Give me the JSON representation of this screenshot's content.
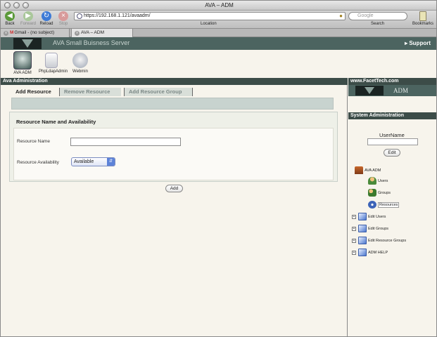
{
  "window": {
    "title": "AVA – ADM"
  },
  "toolbar": {
    "back": "Back",
    "forward": "Forward",
    "reload": "Reload",
    "stop": "Stop",
    "url": "https://192.168.1.121/avaadm/",
    "location_label": "Location",
    "search_placeholder": "Google",
    "search_label": "Search",
    "bookmarks": "Bookmarks"
  },
  "tabs": [
    {
      "label": "Gmail - (no subject)"
    },
    {
      "label": "AVA – ADM"
    }
  ],
  "banner": {
    "title": "AVA Small Buisness Server",
    "support": "▸ Support"
  },
  "apps": [
    {
      "label": "AVA ADM",
      "icon": "ava-adm-icon"
    },
    {
      "label": "PhpLdapAdmin",
      "icon": "phpldapadmin-icon"
    },
    {
      "label": "Webmin",
      "icon": "webmin-icon"
    }
  ],
  "main": {
    "header": "Ava Administration",
    "tabs": [
      {
        "label": "Add Resource"
      },
      {
        "label": "Remove Resource"
      },
      {
        "label": "Add Resource Group"
      }
    ],
    "form": {
      "title": "Resource Name and Availability",
      "name_label": "Resource Name",
      "name_value": "",
      "availability_label": "Resource Availability",
      "availability_value": "Available"
    },
    "add_button": "Add"
  },
  "sidebar": {
    "site": "www.FacetTech.com",
    "logo_text": "ADM",
    "section": "System Administration",
    "username_label": "UserName",
    "username_value": "",
    "edit_button": "Edit",
    "tree": {
      "root": "AVA ADM",
      "children": [
        "Users",
        "Groups",
        "Resources"
      ],
      "sections": [
        "Edit Users",
        "Edit Groups",
        "Edit Resource Groups",
        "ADM HELP"
      ]
    }
  },
  "colors": {
    "header_bg": "#3c4c48",
    "banner_bg": "#4c6460",
    "page_bg": "#f7f4ec"
  }
}
